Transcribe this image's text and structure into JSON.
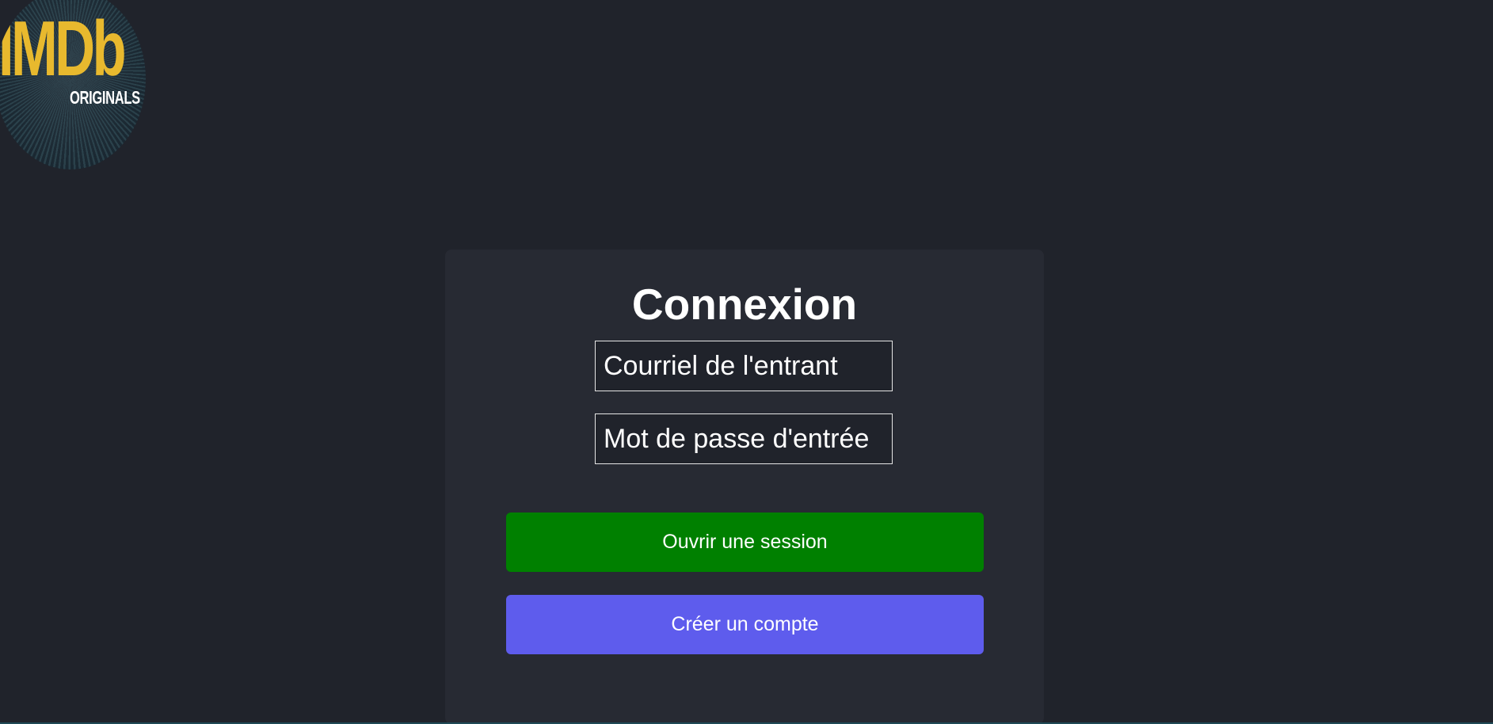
{
  "logo": {
    "word": "IMDb",
    "subtitle": "ORIGINALS"
  },
  "login": {
    "title": "Connexion",
    "email_placeholder": "Courriel de l'entrant",
    "password_placeholder": "Mot de passe d'entrée",
    "login_button": "Ouvrir une session",
    "register_button": "Créer un compte"
  },
  "colors": {
    "background": "#20232b",
    "card": "#272a33",
    "login_button": "#008000",
    "register_button": "#5e5ced",
    "logo_gold": "#e8b92e"
  }
}
